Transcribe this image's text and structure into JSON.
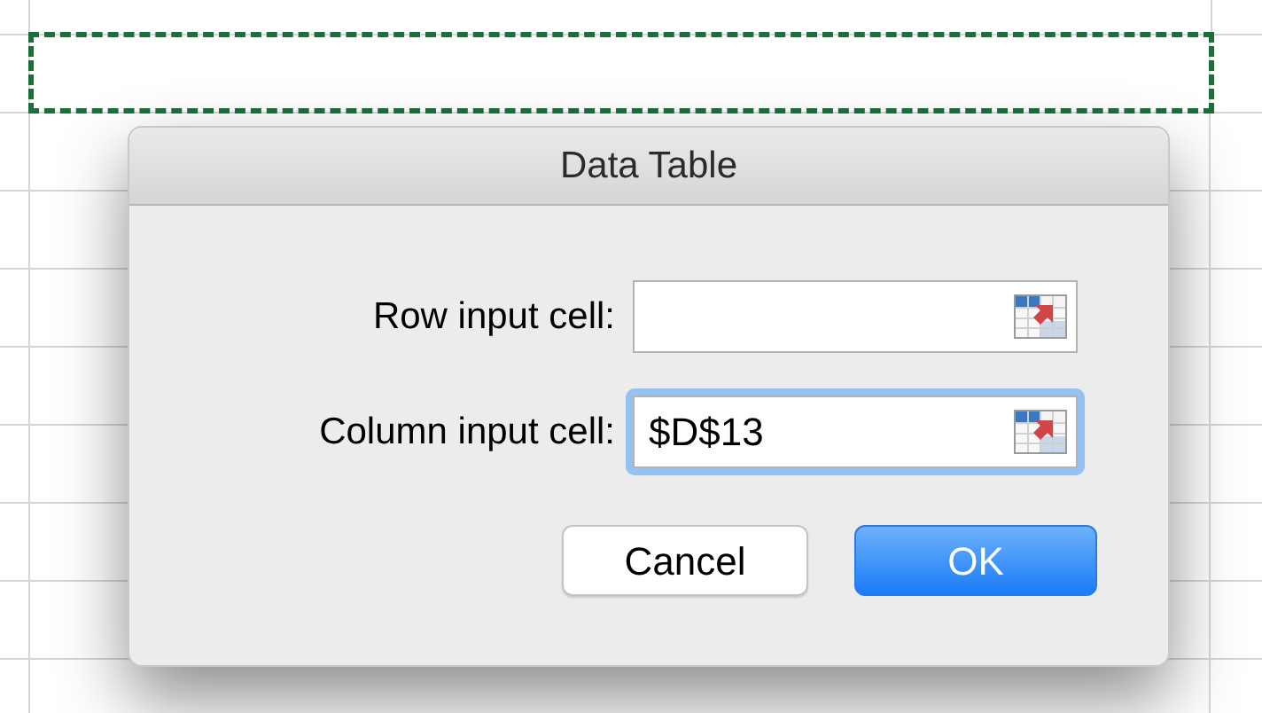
{
  "dialog": {
    "title": "Data Table"
  },
  "fields": [
    {
      "label": "Row input cell:",
      "focused": false
    },
    {
      "label": "Column input cell:",
      "value": "$D$13",
      "focused": true
    }
  ],
  "buttons": [
    {
      "label": "Cancel",
      "default": false
    },
    {
      "label": "OK",
      "default": true
    }
  ]
}
